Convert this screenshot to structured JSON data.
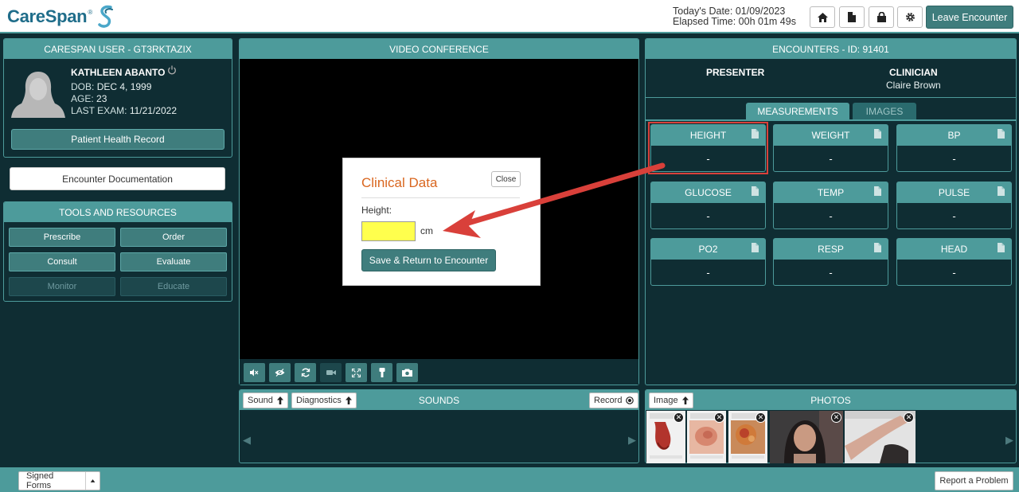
{
  "header": {
    "logo_text": "CareSpan",
    "logo_tm": "®",
    "today_label": "Today's Date: 01/09/2023",
    "elapsed_label": "Elapsed Time: 00h 01m 49s",
    "leave_label": "Leave Encounter",
    "icons": [
      "home-icon",
      "document-icon",
      "lock-icon",
      "gear-icon"
    ]
  },
  "patient": {
    "panel_title": "CARESPAN USER - GT3RKTAZIX",
    "name": "KATHLEEN ABANTO",
    "dob_label": "DOB:",
    "dob": "DEC 4, 1999",
    "age_label": "AGE:",
    "age": "23",
    "exam_label": "LAST EXAM:",
    "exam": "11/21/2022",
    "phr_button": "Patient Health Record"
  },
  "encounter_doc_button": "Encounter Documentation",
  "tools": {
    "title": "TOOLS AND RESOURCES",
    "buttons": [
      "Prescribe",
      "Order",
      "Consult",
      "Evaluate",
      "Monitor",
      "Educate"
    ]
  },
  "video": {
    "title": "VIDEO CONFERENCE",
    "controls": [
      "mute-icon",
      "hide-video-icon",
      "switch-camera-icon",
      "camera-icon",
      "fullscreen-icon",
      "flashlight-icon",
      "snapshot-icon"
    ]
  },
  "modal": {
    "title": "Clinical Data",
    "close_label": "Close",
    "field_label": "Height:",
    "field_value": "",
    "unit": "cm",
    "save_label": "Save & Return to Encounter"
  },
  "encounters": {
    "title": "ENCOUNTERS - ID: 91401",
    "presenter_label": "PRESENTER",
    "clinician_label": "CLINICIAN",
    "clinician_name": "Claire Brown",
    "tabs": [
      "MEASUREMENTS",
      "IMAGES"
    ],
    "measurements": [
      {
        "label": "HEIGHT",
        "value": "-"
      },
      {
        "label": "WEIGHT",
        "value": "-"
      },
      {
        "label": "BP",
        "value": "-"
      },
      {
        "label": "GLUCOSE",
        "value": "-"
      },
      {
        "label": "TEMP",
        "value": "-"
      },
      {
        "label": "PULSE",
        "value": "-"
      },
      {
        "label": "PO2",
        "value": "-"
      },
      {
        "label": "RESP",
        "value": "-"
      },
      {
        "label": "HEAD",
        "value": "-"
      }
    ]
  },
  "sounds": {
    "title": "SOUNDS",
    "sound_button": "Sound",
    "diagnostics_button": "Diagnostics",
    "record_button": "Record"
  },
  "photos": {
    "title": "PHOTOS",
    "image_button": "Image"
  },
  "footer": {
    "signed_forms": "Signed Forms",
    "report_problem": "Report a Problem"
  },
  "colors": {
    "teal": "#4d9b9b",
    "dark_bg": "#0f2d33",
    "button": "#3f7d7d",
    "accent_orange": "#d9661f",
    "highlight_red": "#d9403a",
    "input_yellow": "#ffff4d"
  }
}
